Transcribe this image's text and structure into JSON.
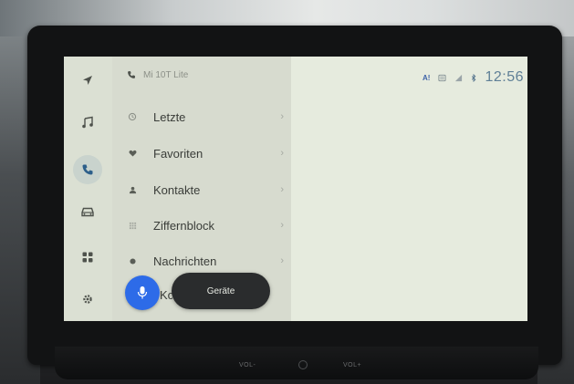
{
  "device": {
    "name": "Mi 10T Lite"
  },
  "status": {
    "clock": "12:56",
    "assistant_badge": "A!",
    "icons": [
      "assistant-icon",
      "message-icon",
      "signal-icon",
      "bluetooth-icon"
    ]
  },
  "rail": {
    "items": [
      {
        "name": "navigation",
        "icon": "navigation-arrow-icon"
      },
      {
        "name": "music",
        "icon": "music-note-icon"
      },
      {
        "name": "phone",
        "icon": "phone-icon",
        "active": true
      },
      {
        "name": "car",
        "icon": "car-icon"
      },
      {
        "name": "apps",
        "icon": "apps-grid-icon"
      },
      {
        "name": "settings",
        "icon": "gear-icon"
      }
    ]
  },
  "phone_menu": {
    "items": [
      {
        "label": "Letzte",
        "icon": "history-icon"
      },
      {
        "label": "Favoriten",
        "icon": "heart-icon"
      },
      {
        "label": "Kontakte",
        "icon": "person-icon"
      },
      {
        "label": "Ziffernblock",
        "icon": "dialpad-icon"
      },
      {
        "label": "Nachrichten",
        "icon": "message-icon"
      }
    ],
    "obscured_item_fragment": "Ko"
  },
  "toast": {
    "label": "Geräte"
  },
  "hardware": {
    "vol_minus": "VOL-",
    "vol_plus": "VOL+"
  },
  "colors": {
    "accent_blue": "#2d6be8",
    "clock": "#5f7f96",
    "screen_bg": "#e3e8db",
    "panel_bg": "#d7dbcf",
    "toast_bg": "#2a2c2d"
  }
}
